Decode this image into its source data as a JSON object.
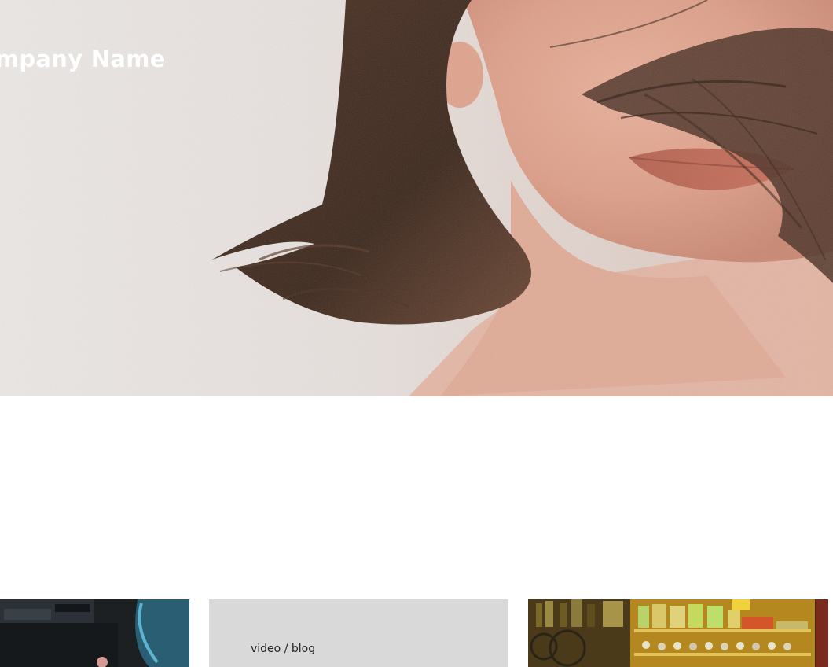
{
  "hero": {
    "brand_name": "Company Name",
    "image": "woman-face-closeup-photo"
  },
  "tiles": [
    {
      "image": "camera-equipment-photo"
    },
    {
      "caption": "video / blog"
    },
    {
      "image": "vintage-shop-shelf-photo"
    }
  ]
}
